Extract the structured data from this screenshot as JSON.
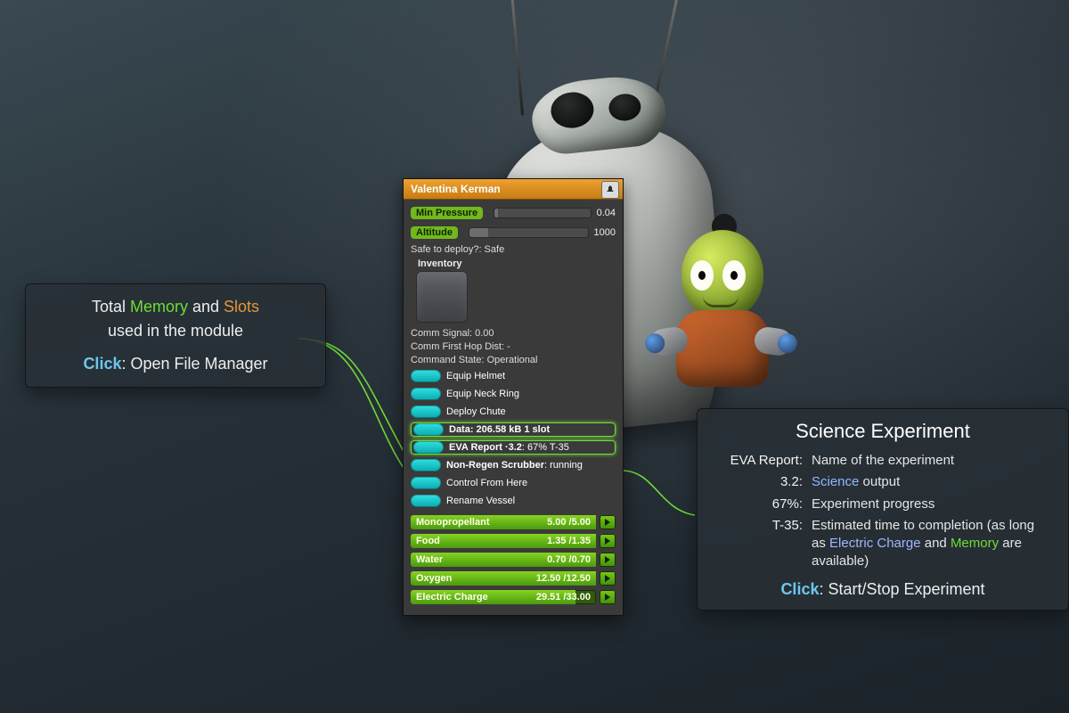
{
  "panel": {
    "title": "Valentina Kerman",
    "min_pressure": {
      "label": "Min Pressure",
      "value": "0.04",
      "fill_pct": 4
    },
    "altitude": {
      "label": "Altitude",
      "value": "1000",
      "fill_pct": 16
    },
    "safe_to_deploy": "Safe to deploy?: Safe",
    "inventory_title": "Inventory",
    "comm_signal": "Comm Signal: 0.00",
    "comm_hop": "Comm First Hop Dist: -",
    "command_state": "Command State: Operational",
    "actions": {
      "equip_helmet": "Equip Helmet",
      "equip_neck": "Equip Neck Ring",
      "deploy_chute": "Deploy Chute",
      "data": "Data: 206.58 kB 1 slot",
      "eva_report_full": "EVA Report ·3.2: 67% T-35",
      "eva_report_prefix": "EVA Report ·3.2",
      "eva_report_suffix": ": 67% T-35",
      "scrubber_prefix": "Non-Regen Scrubber",
      "scrubber_suffix": ": running",
      "control_here": "Control From Here",
      "rename_vessel": "Rename Vessel"
    },
    "resources": {
      "mono": {
        "label": "Monopropellant",
        "value": "5.00 /5.00",
        "pct": 100
      },
      "food": {
        "label": "Food",
        "value": "1.35 /1.35",
        "pct": 100
      },
      "water": {
        "label": "Water",
        "value": "0.70 /0.70",
        "pct": 100
      },
      "oxy": {
        "label": "Oxygen",
        "value": "12.50 /12.50",
        "pct": 100
      },
      "ec": {
        "label": "Electric Charge",
        "value": "29.51 /33.00",
        "pct": 89
      }
    }
  },
  "left_callout": {
    "line1_a": "Total ",
    "line1_mem": "Memory",
    "line1_b": " and ",
    "line1_slot": "Slots",
    "line2": "used in the module",
    "click": "Click",
    "click_rest": ": Open File Manager"
  },
  "right_callout": {
    "title": "Science Experiment",
    "k1": "EVA Report:",
    "v1": "Name of the experiment",
    "k2": "3.2:",
    "v2_a": "",
    "v2_sci": "Science",
    "v2_b": " output",
    "k3": "67%:",
    "v3": "Experiment progress",
    "k4": "T-35:",
    "v4_a": "Estimated time to completion (as long as ",
    "v4_ec": "Electric Charge",
    "v4_b": " and ",
    "v4_mem": "Memory",
    "v4_c": " are available)",
    "click": "Click",
    "click_rest": ": Start/Stop Experiment"
  }
}
